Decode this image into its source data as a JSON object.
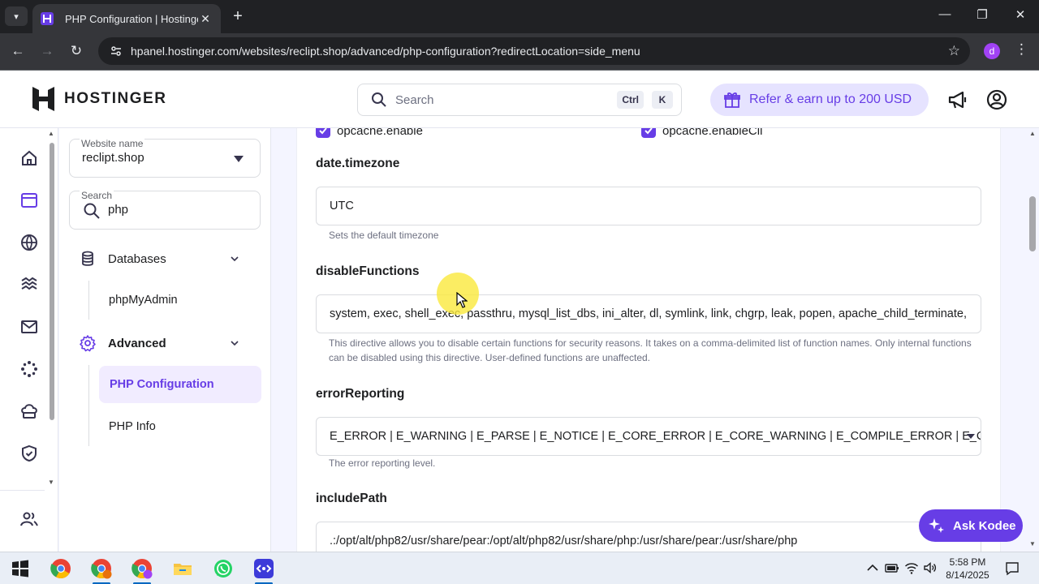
{
  "browser": {
    "tab_title": "PHP Configuration | Hostinger",
    "url": "hpanel.hostinger.com/websites/reclipt.shop/advanced/php-configuration?redirectLocation=side_menu",
    "profile_initial": "d"
  },
  "header": {
    "brand": "HOSTINGER",
    "search_placeholder": "Search",
    "shortcut_key1": "Ctrl",
    "shortcut_key2": "K",
    "refer_label": "Refer & earn up to 200 USD"
  },
  "sidebar": {
    "website_label": "Website name",
    "website_value": "reclipt.shop",
    "search_label": "Search",
    "search_value": "php",
    "groups": [
      {
        "label": "Databases",
        "items": [
          {
            "label": "phpMyAdmin"
          }
        ]
      },
      {
        "label": "Advanced",
        "items": [
          {
            "label": "PHP Configuration",
            "active": true
          },
          {
            "label": "PHP Info"
          }
        ]
      }
    ]
  },
  "main": {
    "checkbox_left": "opcache.enable",
    "checkbox_right": "opcache.enableCli",
    "sections": [
      {
        "key": "date.timezone",
        "value": "UTC",
        "help": "Sets the default timezone"
      },
      {
        "key": "disableFunctions",
        "value": "system, exec, shell_exec, passthru, mysql_list_dbs, ini_alter, dl, symlink, link, chgrp, leak, popen, apache_child_terminate,",
        "help": "This directive allows you to disable certain functions for security reasons. It takes on a comma-delimited list of function names. Only internal functions can be disabled using this directive. User-defined functions are unaffected."
      },
      {
        "key": "errorReporting",
        "value": "E_ERROR | E_WARNING | E_PARSE | E_NOTICE | E_CORE_ERROR | E_CORE_WARNING | E_COMPILE_ERROR | E_COM...",
        "help": "The error reporting level."
      },
      {
        "key": "includePath",
        "value": ".:/opt/alt/php82/usr/share/pear:/opt/alt/php82/usr/share/php:/usr/share/pear:/usr/share/php",
        "help": ""
      }
    ]
  },
  "assistant": {
    "label": "Ask Kodee"
  },
  "taskbar": {
    "time": "5:58 PM",
    "date": "8/14/2025"
  },
  "colors": {
    "brand": "#673de6",
    "brand_light": "#f1ecff"
  }
}
